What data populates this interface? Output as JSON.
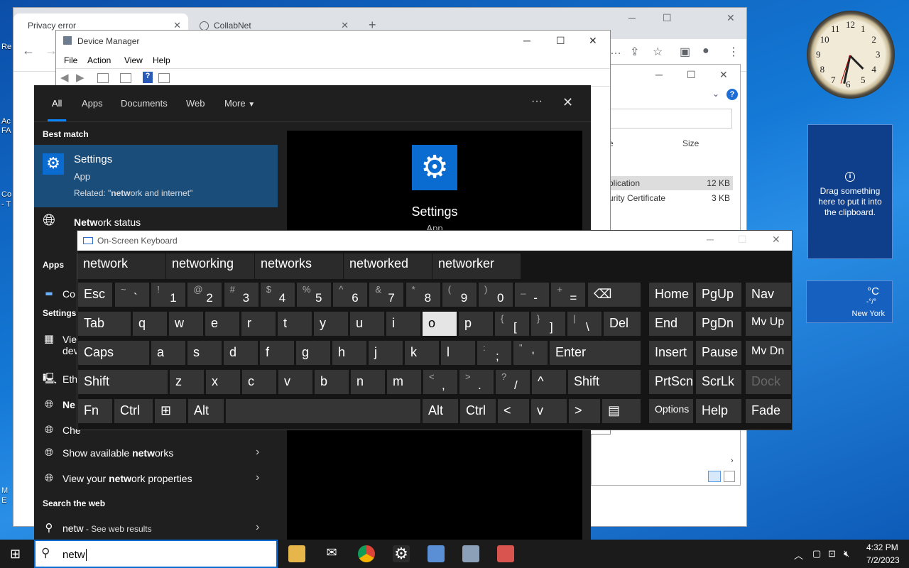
{
  "desktop_fragments": {
    "a": "Re",
    "b": "Ac",
    "c": "FA",
    "d": "Co",
    "e": "- T",
    "f": "M",
    "g": "E"
  },
  "chrome": {
    "tabs": [
      {
        "label": "Privacy error"
      },
      {
        "label": "CollabNet"
      }
    ],
    "new_tab": "+",
    "back": "←",
    "forward": "→"
  },
  "explorer": {
    "col_name": "e",
    "col_size": "Size",
    "rows": [
      {
        "name": "plication",
        "size": "12 KB"
      },
      {
        "name": "urity Certificate",
        "size": "3 KB"
      }
    ]
  },
  "device_manager": {
    "title": "Device Manager",
    "menu": [
      "File",
      "Action",
      "View",
      "Help"
    ]
  },
  "search": {
    "tabs": [
      "All",
      "Apps",
      "Documents",
      "Web",
      "More"
    ],
    "more_menu": "···",
    "close": "✕",
    "best_match_heading": "Best match",
    "best_match": {
      "title": "Settings",
      "subtitle": "App",
      "related_prefix": "Related: \"",
      "related_bold": "netw",
      "related_rest": "ork and internet\""
    },
    "network_status": {
      "bold": "Netw",
      "rest": "ork status"
    },
    "apps_heading": "Apps",
    "apps_item": "Co",
    "settings_heading": "Settings",
    "settings_items": [
      "Vie",
      "dev",
      "Eth",
      "Ne",
      "Che"
    ],
    "items": [
      {
        "bold": "",
        "pre": "Show available ",
        "bold2": "netw",
        "post": "orks"
      },
      {
        "bold": "",
        "pre": "View your ",
        "bold2": "netw",
        "post": "ork properties"
      }
    ],
    "web_heading": "Search the web",
    "web_item": {
      "query": "netw",
      "suffix": " - See web results"
    },
    "preview": {
      "title": "Settings",
      "subtitle": "App"
    }
  },
  "osk": {
    "title": "On-Screen Keyboard",
    "suggestions": [
      "network",
      "networking",
      "networks",
      "networked",
      "networker"
    ],
    "nav_keys": {
      "home": "Home",
      "pgup": "PgUp",
      "nav": "Nav",
      "end": "End",
      "pgdn": "PgDn",
      "mvup": "Mv Up",
      "insert": "Insert",
      "pause": "Pause",
      "mvdn": "Mv Dn",
      "prtscn": "PrtScn",
      "scrlk": "ScrLk",
      "dock": "Dock",
      "options": "Options",
      "help": "Help",
      "fade": "Fade"
    },
    "row1": [
      {
        "main": "Esc"
      },
      {
        "sup": "~",
        "sub": "`"
      },
      {
        "sup": "!",
        "sub": "1"
      },
      {
        "sup": "@",
        "sub": "2"
      },
      {
        "sup": "#",
        "sub": "3"
      },
      {
        "sup": "$",
        "sub": "4"
      },
      {
        "sup": "%",
        "sub": "5"
      },
      {
        "sup": "^",
        "sub": "6"
      },
      {
        "sup": "&",
        "sub": "7"
      },
      {
        "sup": "*",
        "sub": "8"
      },
      {
        "sup": "(",
        "sub": "9"
      },
      {
        "sup": ")",
        "sub": "0"
      },
      {
        "sup": "_",
        "sub": "-"
      },
      {
        "sup": "+",
        "sub": "="
      }
    ],
    "row2": [
      "Tab",
      "q",
      "w",
      "e",
      "r",
      "t",
      "y",
      "u",
      "i",
      "o",
      "p"
    ],
    "row2_sym": [
      {
        "sup": "{",
        "sub": "["
      },
      {
        "sup": "}",
        "sub": "]"
      },
      {
        "sup": "|",
        "sub": "\\"
      }
    ],
    "del": "Del",
    "row3": [
      "Caps",
      "a",
      "s",
      "d",
      "f",
      "g",
      "h",
      "j",
      "k",
      "l"
    ],
    "row3_sym": [
      {
        "sup": ":",
        "sub": ";"
      },
      {
        "sup": "\"",
        "sub": "'"
      }
    ],
    "enter": "Enter",
    "row4": [
      "Shift",
      "z",
      "x",
      "c",
      "v",
      "b",
      "n",
      "m"
    ],
    "row4_sym": [
      {
        "sup": "<",
        "sub": ","
      },
      {
        "sup": ">",
        "sub": "."
      },
      {
        "sup": "?",
        "sub": "/"
      }
    ],
    "up": "^",
    "shift_r": "Shift",
    "row5": {
      "fn": "Fn",
      "ctrl": "Ctrl",
      "alt": "Alt",
      "alt_r": "Alt",
      "ctrl_r": "Ctrl",
      "left": "<",
      "down": "v",
      "right": ">"
    }
  },
  "gadgets": {
    "clock_numbers": [
      "12",
      "1",
      "2",
      "3",
      "4",
      "5",
      "6",
      "7",
      "8",
      "9",
      "10",
      "11"
    ],
    "clipboard_text": "Drag something here to put it into the clipboard.",
    "weather": {
      "unit": "°C",
      "value": "-°/°",
      "city": "New York"
    }
  },
  "taskbar": {
    "search_text": "netw",
    "time": "4:32 PM",
    "date": "7/2/2023"
  }
}
